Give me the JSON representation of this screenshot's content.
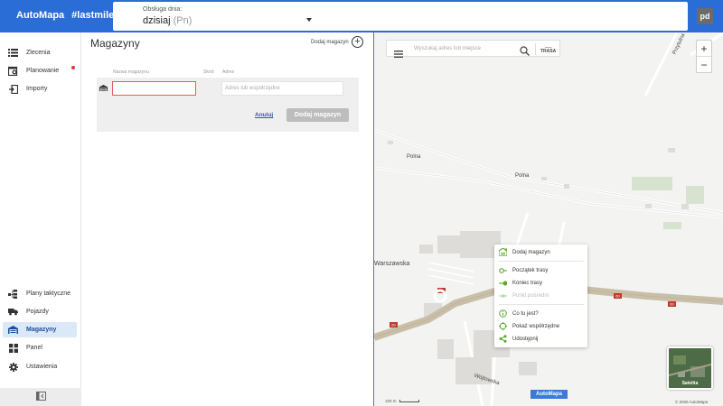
{
  "header": {
    "brand": "AutoMapa",
    "tag": "#lastmile",
    "day_label": "Obsługa dnia:",
    "day_value": "dzisiaj",
    "day_sub": "(Pn)",
    "avatar": "pd"
  },
  "sidebar": {
    "top_items": [
      {
        "label": "Zlecenia",
        "icon": "list-icon"
      },
      {
        "label": "Planowanie",
        "icon": "planning-icon",
        "notification": true
      },
      {
        "label": "Importy",
        "icon": "import-icon"
      }
    ],
    "bottom_items": [
      {
        "label": "Plany taktyczne",
        "icon": "tactical-plan-icon"
      },
      {
        "label": "Pojazdy",
        "icon": "truck-icon"
      },
      {
        "label": "Magazyny",
        "icon": "warehouse-icon",
        "active": true
      },
      {
        "label": "Panel",
        "icon": "dashboard-icon"
      },
      {
        "label": "Ustawienia",
        "icon": "gear-icon"
      }
    ]
  },
  "content": {
    "title": "Magazyny",
    "add_label": "Dodaj magazyn",
    "columns": {
      "name": "Nazwa magazynu",
      "short": "Skrót",
      "address": "Adres"
    },
    "form": {
      "name_value": "",
      "address_placeholder": "Adres lub współrzędne",
      "cancel": "Anuluj",
      "submit": "Dodaj magazyn"
    }
  },
  "map": {
    "search_placeholder": "Wyszukaj adres lub miejsce",
    "route_label": "TRASA",
    "zoom_in": "+",
    "zoom_out": "−",
    "streets": [
      "Polna",
      "Polna",
      "Warszawska",
      "Wójtowska",
      "Przytulna"
    ],
    "context_menu": [
      {
        "label": "Dodaj magazyn",
        "icon": "warehouse-add-icon"
      },
      {
        "label": "Początek trasy",
        "icon": "route-start-icon"
      },
      {
        "label": "Koniec trasy",
        "icon": "route-end-icon"
      },
      {
        "label": "Punkt pośredni",
        "icon": "waypoint-icon",
        "disabled": true
      },
      {
        "label": "Co tu jest?",
        "icon": "info-icon"
      },
      {
        "label": "Pokaż współrzędne",
        "icon": "crosshair-icon"
      },
      {
        "label": "Udostępnij",
        "icon": "share-icon"
      }
    ],
    "road_number": "60",
    "satellite_label": "Satelita",
    "logo": "AutoMapa",
    "scale": "100 m",
    "copyright": "© 2026 AutoMapa"
  },
  "colors": {
    "accent": "#2b6dd6",
    "menu_green": "#5aa832",
    "error": "#e35d5d",
    "road": "#c9bfa8"
  }
}
